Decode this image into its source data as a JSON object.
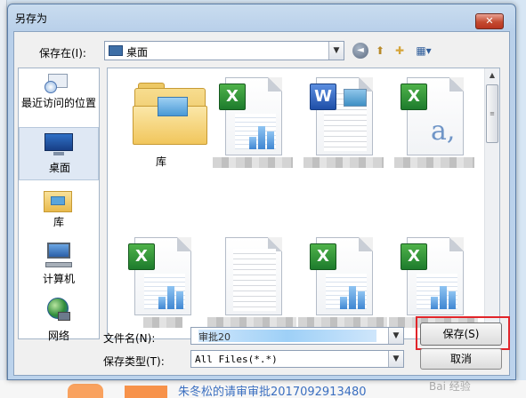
{
  "dialog": {
    "title": "另存为",
    "close_glyph": "✕"
  },
  "save_in": {
    "label": "保存在(I):",
    "value": "桌面"
  },
  "toolbar": {
    "back_glyph": "◄",
    "up_glyph": "⬆",
    "new_folder_glyph": "✚",
    "views_glyph": "▦▾"
  },
  "places": [
    {
      "label": "最近访问的位置",
      "icon": "recent-places-icon"
    },
    {
      "label": "桌面",
      "icon": "desktop-icon"
    },
    {
      "label": "库",
      "icon": "libraries-icon"
    },
    {
      "label": "计算机",
      "icon": "computer-icon"
    },
    {
      "label": "网络",
      "icon": "network-icon"
    }
  ],
  "files": [
    {
      "label": "库",
      "icon": "library-folder-icon"
    },
    {
      "label": "",
      "icon": "excel-file-icon"
    },
    {
      "label": "",
      "icon": "word-file-icon"
    },
    {
      "label": "",
      "icon": "excel-text-file-icon"
    },
    {
      "label": "",
      "icon": "excel-file-icon"
    },
    {
      "label": "",
      "icon": "text-file-icon"
    },
    {
      "label": "",
      "icon": "excel-file-icon"
    },
    {
      "label": "",
      "icon": "excel-file-icon"
    }
  ],
  "file_name": {
    "label": "文件名(N):",
    "value": "审批20"
  },
  "file_type": {
    "label": "保存类型(T):",
    "value": "All Files(*.*)"
  },
  "buttons": {
    "save": "保存(S)",
    "cancel": "取消"
  },
  "background": {
    "bottom_text": "朱冬松的请审审批20170929​13480"
  },
  "watermark": "Bai 经验",
  "colors": {
    "highlight": "#e1252a",
    "excel_green": "#1d7b2c",
    "word_blue": "#1f4fa8"
  }
}
